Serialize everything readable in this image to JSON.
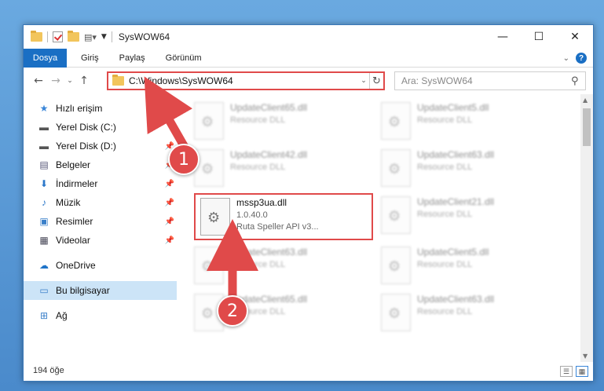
{
  "window": {
    "title": "SysWOW64"
  },
  "ribbon": {
    "file": "Dosya",
    "tabs": [
      "Giriş",
      "Paylaş",
      "Görünüm"
    ]
  },
  "address": {
    "path": "C:\\Windows\\SysWOW64"
  },
  "search": {
    "placeholder": "Ara: SysWOW64"
  },
  "sidebar": {
    "items": [
      {
        "label": "Hızlı erişim",
        "icon": "star-icon"
      },
      {
        "label": "Yerel Disk (C:)",
        "icon": "drive-icon"
      },
      {
        "label": "Yerel Disk (D:)",
        "icon": "drive-icon"
      },
      {
        "label": "Belgeler",
        "icon": "document-icon"
      },
      {
        "label": "İndirmeler",
        "icon": "download-icon"
      },
      {
        "label": "Müzik",
        "icon": "music-icon"
      },
      {
        "label": "Resimler",
        "icon": "pictures-icon"
      },
      {
        "label": "Videolar",
        "icon": "video-icon"
      },
      {
        "label": "OneDrive",
        "icon": "cloud-icon"
      },
      {
        "label": "Bu bilgisayar",
        "icon": "computer-icon"
      },
      {
        "label": "Ağ",
        "icon": "network-icon"
      }
    ]
  },
  "files": [
    {
      "name": "UpdateClient65.dll",
      "desc": "Resource DLL"
    },
    {
      "name": "UpdateClient5.dll",
      "desc": "Resource DLL"
    },
    {
      "name": "UpdateClient42.dll",
      "desc": "Resource DLL"
    },
    {
      "name": "UpdateClient63.dll",
      "desc": "Resource DLL"
    },
    {
      "name": "UpdateClient21.dll",
      "desc": "Resource DLL"
    },
    {
      "name": "UpdateClient63.dll",
      "desc": "Resource DLL"
    },
    {
      "name": "UpdateClient5.dll",
      "desc": "Resource DLL"
    },
    {
      "name": "UpdateClient65.dll",
      "desc": "Resource DLL"
    },
    {
      "name": "UpdateClient63.dll",
      "desc": "Resource DLL"
    }
  ],
  "highlighted_file": {
    "name": "mssp3ua.dll",
    "version": "1.0.40.0",
    "desc": "Ruta Speller API v3..."
  },
  "status": {
    "count": "194 öğe"
  },
  "annotations": {
    "step1": "1",
    "step2": "2"
  },
  "colors": {
    "accent": "#1a6fc4",
    "highlight": "#e04a4a"
  }
}
